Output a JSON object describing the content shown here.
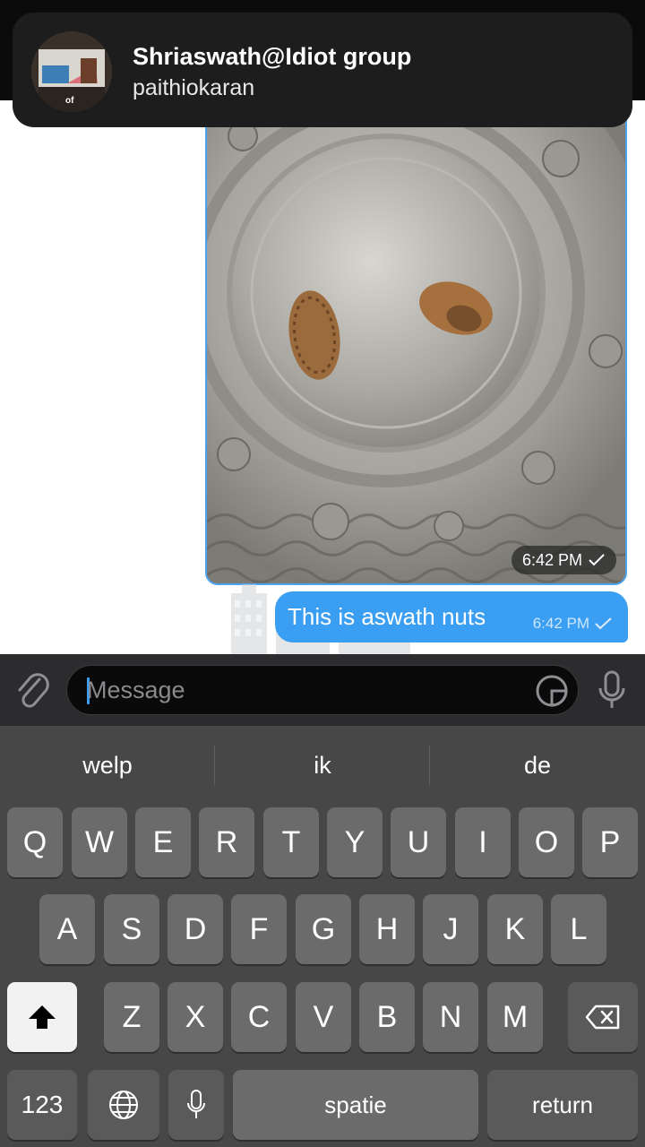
{
  "notification": {
    "title": "Shriaswath@Idiot group",
    "body": "paithiokaran",
    "avatar_label": "of"
  },
  "chat": {
    "photo_message": {
      "time": "6:42 PM",
      "status_icon": "checkmark-icon"
    },
    "text_message": {
      "text": "This is aswath nuts",
      "time": "6:42 PM",
      "status_icon": "checkmark-icon"
    }
  },
  "input_bar": {
    "attach_icon": "paperclip-icon",
    "placeholder": "Message",
    "sticker_icon": "sticker-icon",
    "mic_icon": "microphone-icon"
  },
  "keyboard": {
    "suggestions": [
      "welp",
      "ik",
      "de"
    ],
    "row1": [
      "Q",
      "W",
      "E",
      "R",
      "T",
      "Y",
      "U",
      "I",
      "O",
      "P"
    ],
    "row2": [
      "A",
      "S",
      "D",
      "F",
      "G",
      "H",
      "J",
      "K",
      "L"
    ],
    "row3": [
      "Z",
      "X",
      "C",
      "V",
      "B",
      "N",
      "M"
    ],
    "numbers_label": "123",
    "space_label": "spatie",
    "return_label": "return"
  },
  "colors": {
    "accent": "#3a9ef2",
    "banner_bg": "#1d1d1d",
    "keyboard_bg": "#474747",
    "key_bg": "#6b6b6b"
  }
}
